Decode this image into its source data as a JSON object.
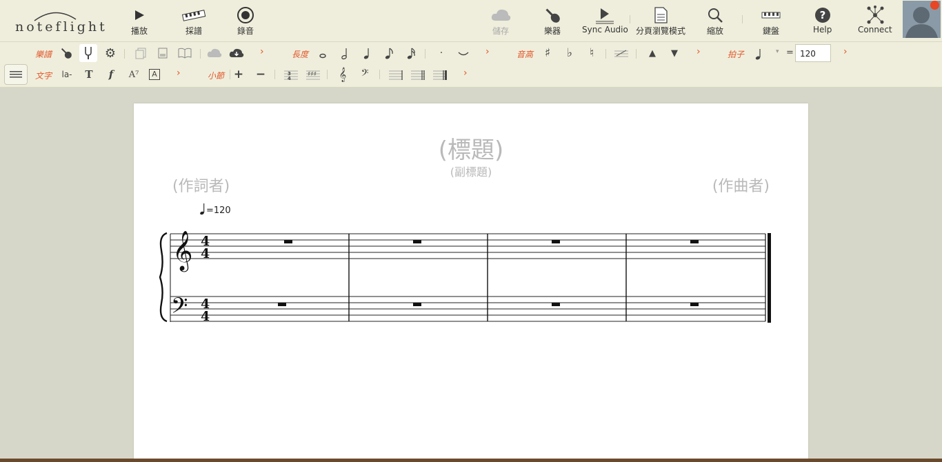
{
  "app": {
    "logo_text": "noteflight"
  },
  "topbar": {
    "play": "播放",
    "transcribe": "採譜",
    "record": "錄音",
    "save": "儲存",
    "instrument": "樂器",
    "sync_audio": "Sync Audio",
    "page_view": "分頁瀏覽模式",
    "zoom": "縮放",
    "keyboard": "鍵盤",
    "help": "Help",
    "connect": "Connect"
  },
  "toolbar": {
    "row1": {
      "score_label": "樂譜",
      "duration_label": "長度",
      "pitch_label": "音高",
      "beat_label": "拍子",
      "tempo_equals": "=",
      "tempo_value": "120",
      "more": "›"
    },
    "row2": {
      "text_label": "文字",
      "lyric_icon": "la-",
      "text_icon": "T",
      "dynamic_icon": "f",
      "chord_icon": "A⁷",
      "box_icon": "A",
      "measure_label": "小節",
      "add": "+",
      "remove": "−",
      "more": "›"
    }
  },
  "score": {
    "title": "(標題)",
    "subtitle": "(副標題)",
    "lyricist": "(作詞者)",
    "composer": "(作曲者)",
    "tempo": "=120",
    "time_signature": [
      "4",
      "4"
    ],
    "measures": 4
  },
  "colors": {
    "accent": "#e2572b",
    "background": "#d6d7c9",
    "toolbar": "#efeedc"
  }
}
